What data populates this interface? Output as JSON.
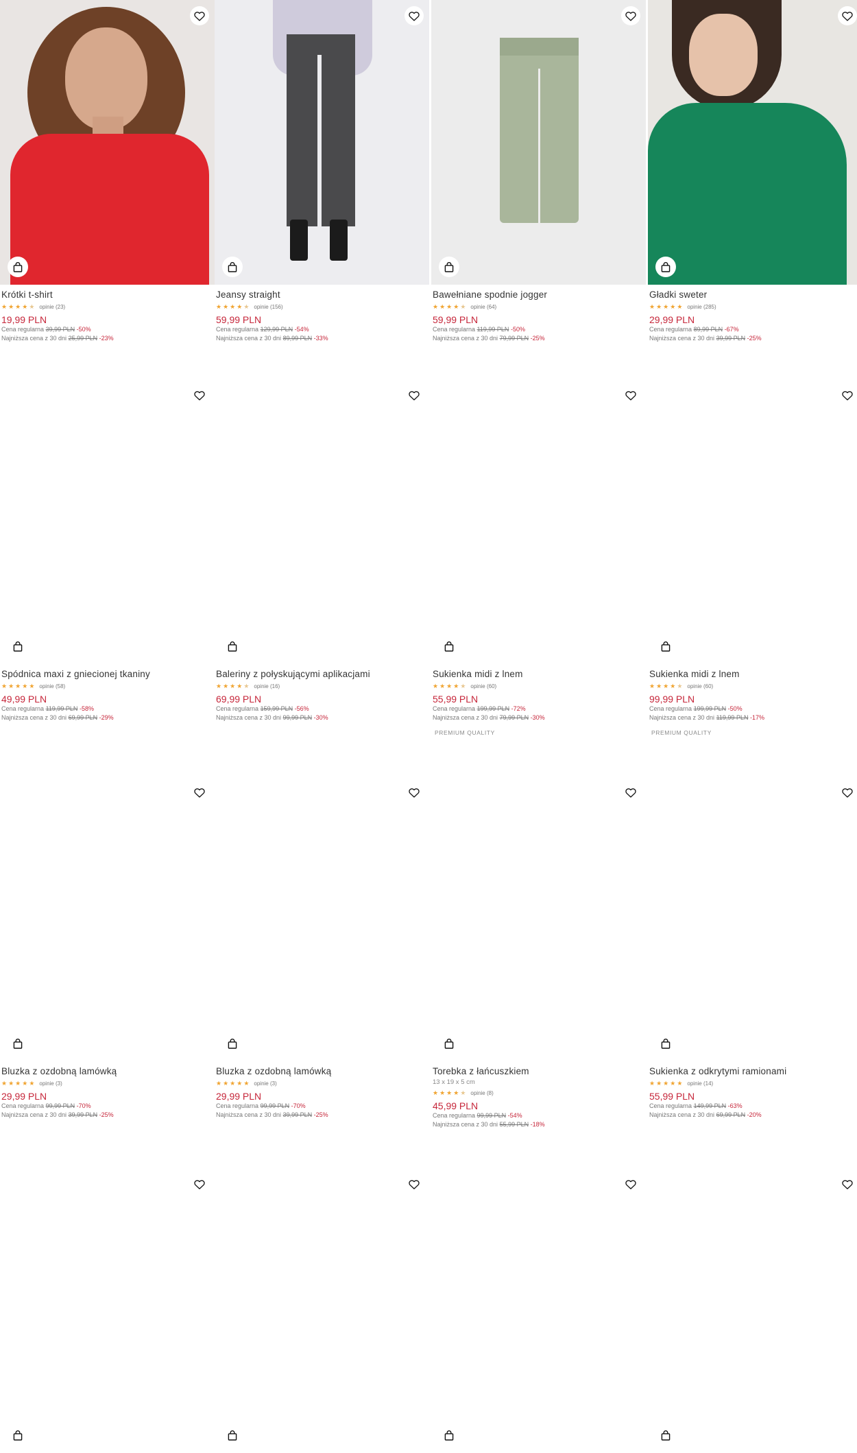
{
  "colors": {
    "price": "#c6263a",
    "star": "#f0a431",
    "photo_bg": "#eeeeef"
  },
  "icons": {
    "favorite": "heart-icon",
    "cart": "shopping-bag-icon",
    "rating": "star-icon"
  },
  "strings": {
    "reviews_prefix": "opinie",
    "regular_label": "Cena regularna",
    "lowest_label": "Najniższa cena z 30 dni"
  },
  "products": [
    {
      "name": "Krótki t-shirt",
      "rating": 4.5,
      "reviews": "opinie (23)",
      "price": "19,99 PLN",
      "regular": {
        "label": "Cena regularna",
        "old": "39,99 PLN",
        "disc": "-50%"
      },
      "lowest": {
        "label": "Najniższa cena z 30 dni",
        "old": "25,99 PLN",
        "disc": "-23%"
      }
    },
    {
      "name": "Jeansy straight",
      "rating": 4.5,
      "reviews": "opinie (156)",
      "price": "59,99 PLN",
      "regular": {
        "label": "Cena regularna",
        "old": "129,99 PLN",
        "disc": "-54%"
      },
      "lowest": {
        "label": "Najniższa cena z 30 dni",
        "old": "89,99 PLN",
        "disc": "-33%"
      }
    },
    {
      "name": "Bawełniane spodnie jogger",
      "rating": 4.5,
      "reviews": "opinie (64)",
      "price": "59,99 PLN",
      "regular": {
        "label": "Cena regularna",
        "old": "119,99 PLN",
        "disc": "-50%"
      },
      "lowest": {
        "label": "Najniższa cena z 30 dni",
        "old": "79,99 PLN",
        "disc": "-25%"
      }
    },
    {
      "name": "Gładki sweter",
      "rating": 5,
      "reviews": "opinie (285)",
      "price": "29,99 PLN",
      "regular": {
        "label": "Cena regularna",
        "old": "89,99 PLN",
        "disc": "-67%"
      },
      "lowest": {
        "label": "Najniższa cena z 30 dni",
        "old": "39,99 PLN",
        "disc": "-25%"
      }
    },
    {
      "name": "Spódnica maxi z gniecionej tkaniny",
      "rating": 5,
      "reviews": "opinie (58)",
      "price": "49,99 PLN",
      "regular": {
        "label": "Cena regularna",
        "old": "119,99 PLN",
        "disc": "-58%"
      },
      "lowest": {
        "label": "Najniższa cena z 30 dni",
        "old": "69,99 PLN",
        "disc": "-29%"
      }
    },
    {
      "name": "Baleriny z połyskującymi aplikacjami",
      "rating": 4.5,
      "reviews": "opinie (16)",
      "price": "69,99 PLN",
      "regular": {
        "label": "Cena regularna",
        "old": "159,99 PLN",
        "disc": "-56%"
      },
      "lowest": {
        "label": "Najniższa cena z 30 dni",
        "old": "99,99 PLN",
        "disc": "-30%"
      }
    },
    {
      "name": "Sukienka midi z lnem",
      "rating": 4.5,
      "reviews": "opinie (60)",
      "price": "55,99 PLN",
      "regular": {
        "label": "Cena regularna",
        "old": "199,99 PLN",
        "disc": "-72%"
      },
      "lowest": {
        "label": "Najniższa cena z 30 dni",
        "old": "79,99 PLN",
        "disc": "-30%"
      },
      "badge": "PREMIUM QUALITY"
    },
    {
      "name": "Sukienka midi z lnem",
      "rating": 4.5,
      "reviews": "opinie (60)",
      "price": "99,99 PLN",
      "regular": {
        "label": "Cena regularna",
        "old": "199,99 PLN",
        "disc": "-50%"
      },
      "lowest": {
        "label": "Najniższa cena z 30 dni",
        "old": "119,99 PLN",
        "disc": "-17%"
      },
      "badge": "PREMIUM QUALITY"
    },
    {
      "name": "Bluzka z ozdobną lamówką",
      "rating": 5,
      "reviews": "opinie (3)",
      "price": "29,99 PLN",
      "regular": {
        "label": "Cena regularna",
        "old": "99,99 PLN",
        "disc": "-70%"
      },
      "lowest": {
        "label": "Najniższa cena z 30 dni",
        "old": "39,99 PLN",
        "disc": "-25%"
      }
    },
    {
      "name": "Bluzka z ozdobną lamówką",
      "rating": 5,
      "reviews": "opinie (3)",
      "price": "29,99 PLN",
      "regular": {
        "label": "Cena regularna",
        "old": "99,99 PLN",
        "disc": "-70%"
      },
      "lowest": {
        "label": "Najniższa cena z 30 dni",
        "old": "39,99 PLN",
        "disc": "-25%"
      }
    },
    {
      "name": "Torebka z łańcuszkiem",
      "dims": "13 x 19 x 5 cm",
      "rating": 4.5,
      "reviews": "opinie (8)",
      "price": "45,99 PLN",
      "regular": {
        "label": "Cena regularna",
        "old": "99,99 PLN",
        "disc": "-54%"
      },
      "lowest": {
        "label": "Najniższa cena z 30 dni",
        "old": "55,99 PLN",
        "disc": "-18%"
      }
    },
    {
      "name": "Sukienka z odkrytymi ramionami",
      "rating": 5,
      "reviews": "opinie (14)",
      "price": "55,99 PLN",
      "regular": {
        "label": "Cena regularna",
        "old": "149,99 PLN",
        "disc": "-63%"
      },
      "lowest": {
        "label": "Najniższa cena z 30 dni",
        "old": "69,99 PLN",
        "disc": "-20%"
      }
    },
    {
      "name": ""
    },
    {
      "name": ""
    },
    {
      "name": ""
    },
    {
      "name": ""
    }
  ]
}
